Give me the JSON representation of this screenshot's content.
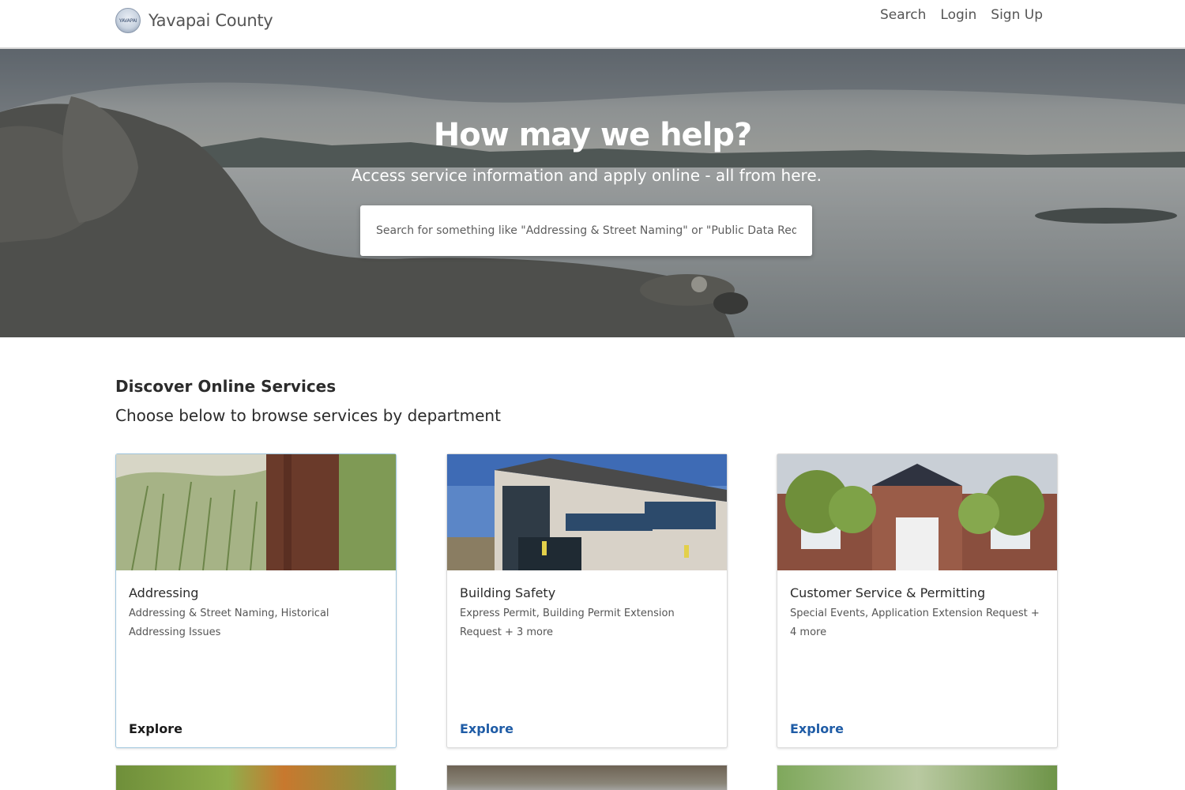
{
  "header": {
    "brand_name": "Yavapai County",
    "seal_text": "YAVAPAI",
    "nav": {
      "search": "Search",
      "login": "Login",
      "signup": "Sign Up"
    }
  },
  "hero": {
    "title": "How may we help?",
    "subtitle": "Access service information and apply online - all from here.",
    "search_placeholder": "Search for something like \"Addressing & Street Naming\" or \"Public Data Requ..."
  },
  "services": {
    "title": "Discover Online Services",
    "subtitle": "Choose below to browse services by department",
    "cards": [
      {
        "title": "Addressing",
        "description": "Addressing & Street Naming, Historical Addressing Issues",
        "link": "Explore",
        "image": "address-post-photo"
      },
      {
        "title": "Building Safety",
        "description": "Express Permit, Building Permit Extension Request + 3 more",
        "link": "Explore",
        "image": "building-photo"
      },
      {
        "title": "Customer Service & Permitting",
        "description": "Special Events, Application Extension Request + 4 more",
        "link": "Explore",
        "image": "brick-building-photo"
      }
    ]
  },
  "colors": {
    "link": "#1f5ca6",
    "active_border": "#9fc6de"
  }
}
